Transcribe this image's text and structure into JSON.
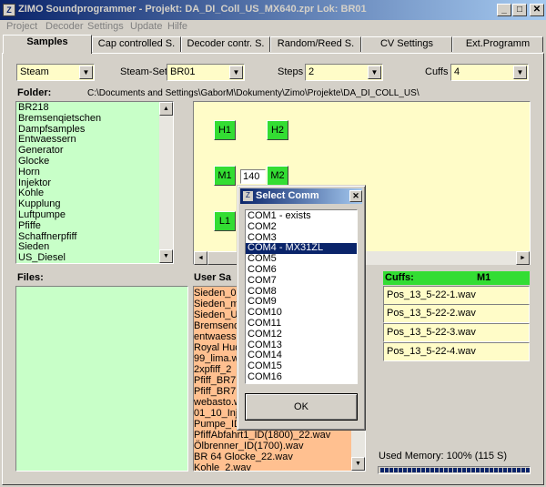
{
  "window": {
    "title": "ZIMO Soundprogrammer - Projekt: DA_DI_Coll_US_MX640.zpr  Lok: BR01",
    "icon_text": "Z",
    "minimize_glyph": "_",
    "maximize_glyph": "□",
    "close_glyph": "✕"
  },
  "menu": [
    "Project",
    "Decoder",
    "Settings",
    "Update",
    "Hilfe"
  ],
  "tabs": [
    {
      "label": "Samples",
      "active": true
    },
    {
      "label": "Cap controlled S."
    },
    {
      "label": "Decoder contr. S."
    },
    {
      "label": "Random/Reed S."
    },
    {
      "label": "CV Settings"
    },
    {
      "label": "Ext.Programm"
    }
  ],
  "controls": {
    "type_value": "Steam",
    "steam_set_label": "Steam-Set",
    "steam_set_value": "BR01",
    "steps_label": "Steps",
    "steps_value": "2",
    "cuffs_label": "Cuffs",
    "cuffs_value": "4"
  },
  "folder": {
    "label": "Folder:",
    "path": "C:\\Documents and Settings\\GaborM\\Dokumenty\\Zimo\\Projekte\\DA_DI_COLL_US\\",
    "items": [
      "BR218",
      "Bremsenqietschen",
      "Dampfsamples",
      "Entwaessern",
      "Generator",
      "Glocke",
      "Horn",
      "Injektor",
      "Kohle",
      "Kupplung",
      "Luftpumpe",
      "Pfiffe",
      "Schaffnerpfiff",
      "Sieden",
      "US_Diesel"
    ]
  },
  "slots": {
    "h1": "H1",
    "h2": "H2",
    "m1": "M1",
    "m2": "M2",
    "l1": "L1",
    "m1_value": "140"
  },
  "files": {
    "label": "Files:"
  },
  "user_samples": {
    "label": "User Sa",
    "items": [
      "Sieden_07",
      "Sieden_m",
      "Sieden_U",
      "Bremsenq",
      "entwaesse",
      "Royal Hud",
      "99_lima.w",
      "2xpfiff_2",
      "Pfiff_BR7",
      "Pfiff_BR7",
      "webasto.w",
      "01_10_Inj",
      "Pumpe_ID",
      "PfiffAbfahrt1_ID(1800)_22.wav",
      "Ölbrenner_ID(1700).wav",
      "BR 64 Glocke_22.wav",
      "Kohle_2.wav"
    ]
  },
  "cuffs": {
    "label": "Cuffs:",
    "slot": "M1",
    "items": [
      "Pos_13_5-22-1.wav",
      "Pos_13_5-22-2.wav",
      "Pos_13_5-22-3.wav",
      "Pos_13_5-22-4.wav"
    ]
  },
  "memory": {
    "label": "Used Memory: 100% (115 S)",
    "fraction": 1.0
  },
  "dialog": {
    "title": "Select Comm",
    "close_glyph": "✕",
    "ok_label": "OK",
    "ports": [
      "COM1 - exists",
      "COM2",
      "COM3",
      "COM4 - MX31ZL",
      "COM5",
      "COM6",
      "COM7",
      "COM8",
      "COM9",
      "COM10",
      "COM11",
      "COM12",
      "COM13",
      "COM14",
      "COM15",
      "COM16"
    ],
    "selected_index": 3
  },
  "icons": {
    "scroll_up": "▲",
    "scroll_down": "▼",
    "scroll_left": "◄",
    "scroll_right": "►",
    "dropdown": "▼"
  },
  "colors": {
    "list_green": "#c8ffc8",
    "combo_yellow": "#fffcc8",
    "slot_green": "#33dd33",
    "user_orange": "#ffc090",
    "selection": "#0a246a"
  }
}
